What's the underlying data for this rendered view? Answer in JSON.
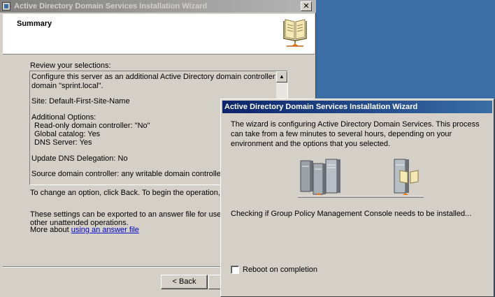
{
  "background_wizard": {
    "title": "Active Directory Domain Services Installation Wizard",
    "close_glyph": "✕",
    "header_title": "Summary",
    "header_icon": "book-icon",
    "review_label": "Review your selections:",
    "selections": [
      "Configure this server as an additional Active Directory domain controller for the",
      "domain \"sprint.local\".",
      "",
      "Site: Default-First-Site-Name",
      "",
      "Additional Options:",
      "  Read-only domain controller: \"No\"",
      "  Global catalog: Yes",
      "  DNS Server: Yes",
      "",
      "Update DNS Delegation: No",
      "",
      "Source domain controller: any writable domain controller"
    ],
    "change_text": "To change an option, click Back. To begin the operation, click N",
    "export_text_1": "These settings can be exported to an answer file for use with",
    "export_text_2": "other unattended operations.",
    "more_about": "More about ",
    "answer_file_link": "using an answer file",
    "back_button": "< Back"
  },
  "progress_dialog": {
    "title": "Active Directory Domain Services Installation Wizard",
    "description": "The wizard is configuring Active Directory Domain Services. This process can take from a few minutes to several hours, depending on your environment and the options that you selected.",
    "status": "Checking if Group Policy Management Console needs to be installed...",
    "reboot_label": "Reboot on completion",
    "reboot_checked": false,
    "graphic_icons": [
      "server-cluster-icon",
      "server-with-book-icon"
    ]
  },
  "colors": {
    "desktop": "#3a6ea5",
    "inactive_title": "#808080",
    "active_title": "#0a246a",
    "window_face": "#d4d0c8",
    "link": "#0000cc"
  }
}
